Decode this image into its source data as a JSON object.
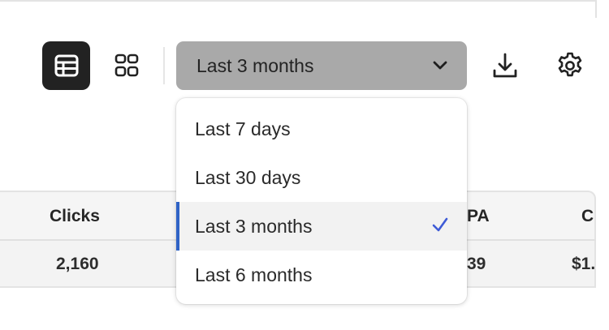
{
  "toolbar": {
    "date_range": {
      "value": "Last 3 months",
      "options": [
        {
          "label": "Last 7 days",
          "selected": false
        },
        {
          "label": "Last 30 days",
          "selected": false
        },
        {
          "label": "Last 3 months",
          "selected": true
        },
        {
          "label": "Last 6 months",
          "selected": false
        }
      ]
    },
    "icons": {
      "table_view": "table-view-icon",
      "card_view": "card-view-icon",
      "dropdown": "chevron-down-icon",
      "download": "download-icon",
      "settings": "gear-icon",
      "selected": "checkmark-icon"
    }
  },
  "table": {
    "headers": {
      "clicks": "Clicks",
      "cpa_partial": "PA",
      "next_partial": "C"
    },
    "row": {
      "clicks": "2,160",
      "cpa_partial": "39",
      "next_partial": "$1."
    }
  },
  "colors": {
    "accent": "#2f63c6",
    "checkmark": "#3e5bd6",
    "picker_bg": "#a9a9a9",
    "active_view_bg": "#222222"
  }
}
